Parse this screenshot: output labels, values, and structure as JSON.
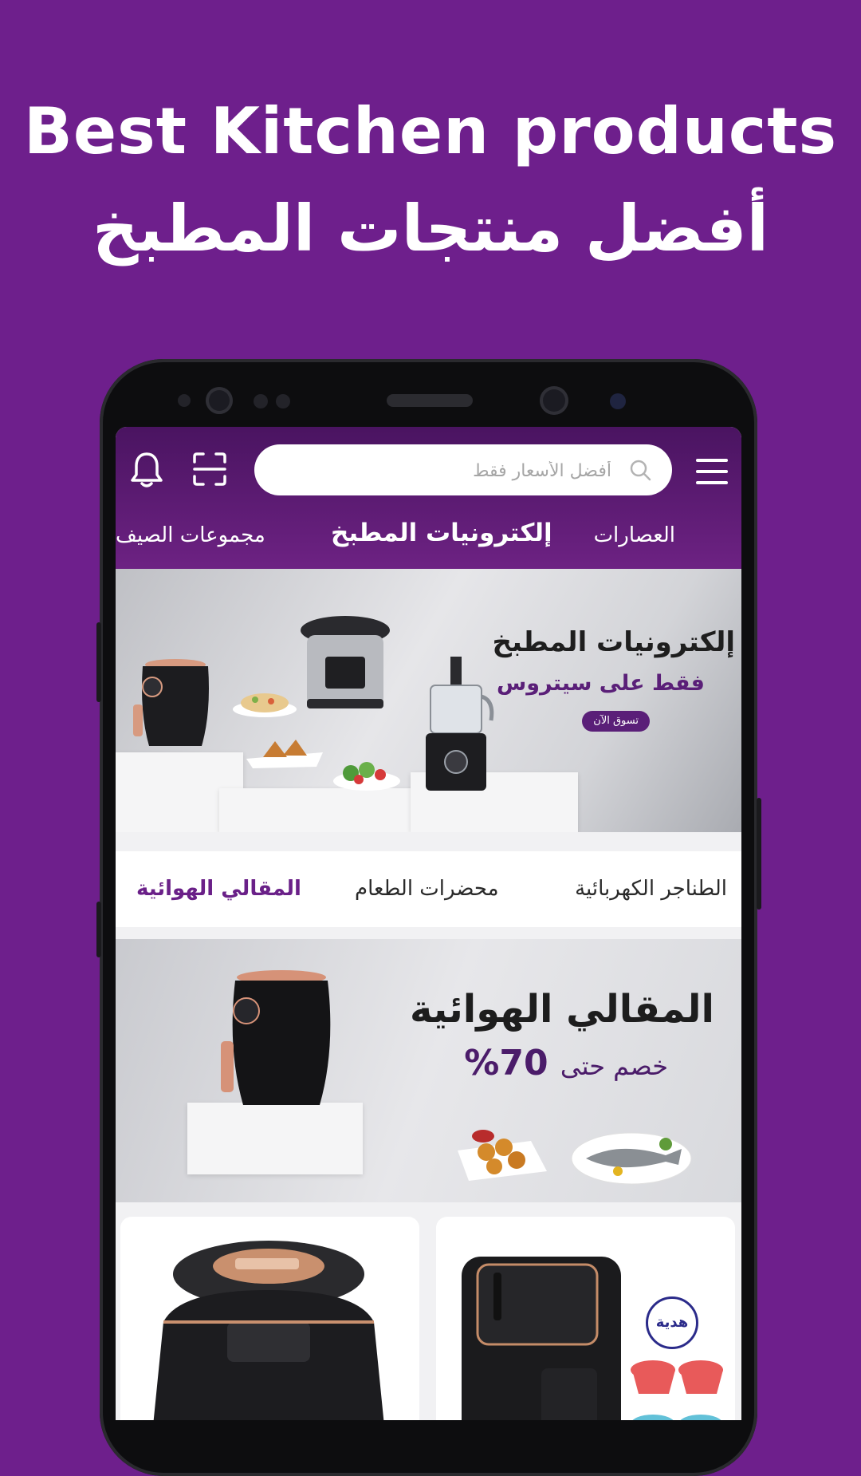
{
  "promo": {
    "title_en": "Best Kitchen products",
    "title_ar": "أفضل منتجات المطبخ"
  },
  "header": {
    "search_placeholder": "أفضل الأسعار فقط",
    "categories": [
      "العصارات",
      "إلكترونيات المطبخ",
      "مجموعات الصيف"
    ]
  },
  "banner1": {
    "title": "إلكترونيات المطبخ",
    "subtitle": "فقط على سيتروس",
    "button": "تسوق الآن"
  },
  "subtabs": [
    "الطناجر الكهربائية",
    "محضرات الطعام",
    "المقالي الهوائية"
  ],
  "banner2": {
    "title": "المقالي الهوائية",
    "subtitle_prefix": "خصم حتى",
    "subtitle_value": "70%"
  },
  "products": {
    "gift_badge": "هدية"
  },
  "colors": {
    "background": "#6e1f8c",
    "header": "#5b1a75",
    "accent": "#6a2088"
  }
}
